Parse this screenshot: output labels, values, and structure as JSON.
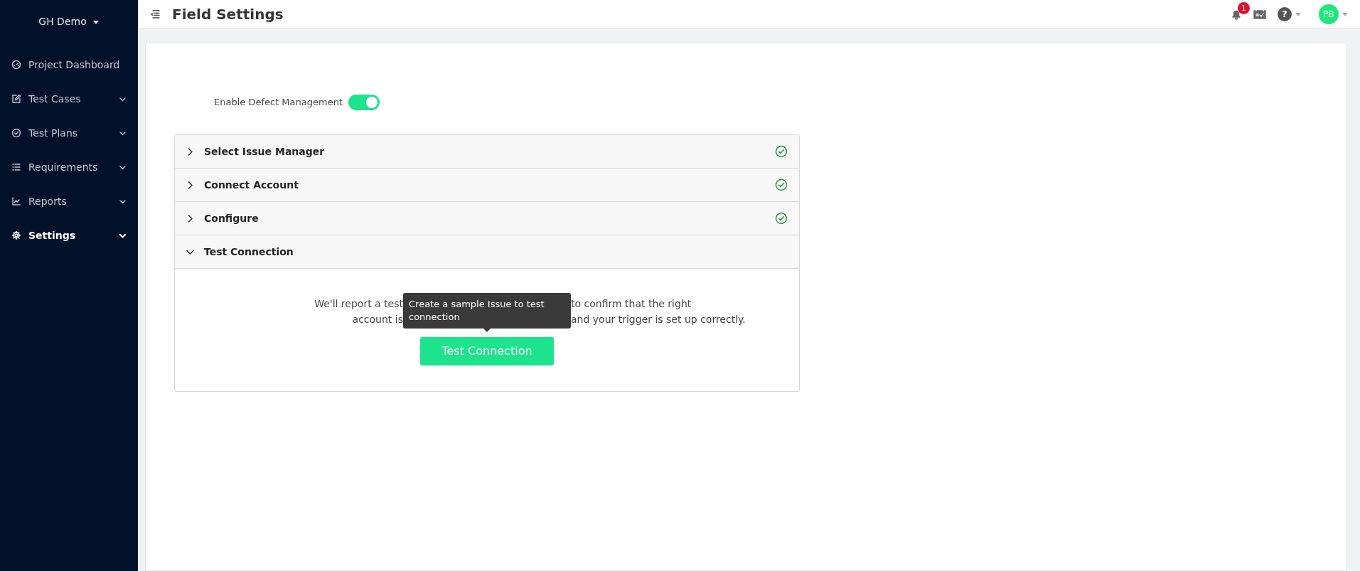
{
  "sidebar": {
    "project": "GH Demo",
    "items": [
      {
        "label": "Project Dashboard",
        "has_caret": false,
        "selected": false
      },
      {
        "label": "Test Cases",
        "has_caret": true,
        "selected": false
      },
      {
        "label": "Test Plans",
        "has_caret": true,
        "selected": false
      },
      {
        "label": "Requirements",
        "has_caret": true,
        "selected": false
      },
      {
        "label": "Reports",
        "has_caret": true,
        "selected": false
      },
      {
        "label": "Settings",
        "has_caret": true,
        "selected": true
      }
    ]
  },
  "header": {
    "title": "Field Settings",
    "notification_count": "1",
    "help_icon": "?",
    "avatar": "PB"
  },
  "toggle": {
    "label": "Enable Defect Management",
    "on": true
  },
  "accordion": [
    {
      "title": "Select Issue Manager",
      "expanded": false,
      "completed": true
    },
    {
      "title": "Connect Account",
      "expanded": false,
      "completed": true
    },
    {
      "title": "Configure",
      "expanded": false,
      "completed": true
    },
    {
      "title": "Test Connection",
      "expanded": true,
      "completed": false
    }
  ],
  "test_connection": {
    "description_parts": [
      "We'll report a test",
      "to confirm that the right",
      "account is",
      "and your trigger is set up correctly."
    ],
    "button": "Test Connection",
    "tooltip": "Create a sample Issue to test connection"
  }
}
